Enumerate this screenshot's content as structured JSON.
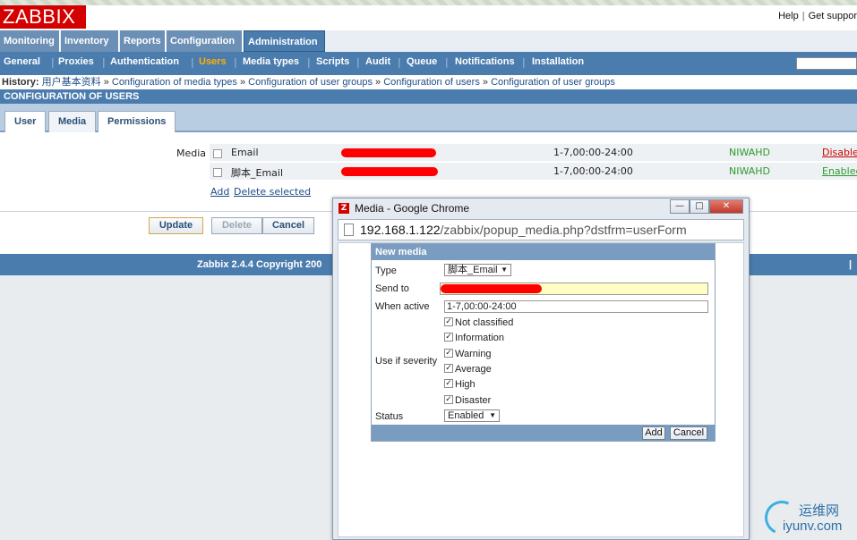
{
  "app": {
    "logo": "ZABBIX",
    "help": "Help",
    "separator": "|",
    "support": "Get suppor"
  },
  "main_menu": [
    {
      "label": "Monitoring"
    },
    {
      "label": "Inventory"
    },
    {
      "label": "Reports"
    },
    {
      "label": "Configuration"
    },
    {
      "label": "Administration"
    }
  ],
  "sub_menu": [
    {
      "label": "General"
    },
    {
      "label": "Proxies"
    },
    {
      "label": "Authentication"
    },
    {
      "label": "Users"
    },
    {
      "label": "Media types"
    },
    {
      "label": "Scripts"
    },
    {
      "label": "Audit"
    },
    {
      "label": "Queue"
    },
    {
      "label": "Notifications"
    },
    {
      "label": "Installation"
    }
  ],
  "history": {
    "label": "History:",
    "items": [
      "用户基本资料",
      "Configuration of media types",
      "Configuration of user groups",
      "Configuration of users",
      "Configuration of user groups"
    ],
    "arrow": "»"
  },
  "page_header": "CONFIGURATION OF USERS",
  "tabs": [
    {
      "label": "User"
    },
    {
      "label": "Media"
    },
    {
      "label": "Permissions"
    }
  ],
  "media_section": {
    "label": "Media",
    "rows": [
      {
        "type": "Email",
        "when": "1-7,00:00-24:00",
        "severity": "NIWAHD",
        "status": "Disabled"
      },
      {
        "type": "脚本_Email",
        "when": "1-7,00:00-24:00",
        "severity": "NIWAHD",
        "status": "Enabled"
      }
    ],
    "add_link": "Add",
    "delete_link": "Delete selected"
  },
  "buttons": {
    "update": "Update",
    "delete": "Delete",
    "cancel": "Cancel"
  },
  "footer": "Zabbix 2.4.4 Copyright 200",
  "footer_right": "|",
  "popup": {
    "title": "Media - Google Chrome",
    "url_host": "192.168.1.122",
    "url_path": "/zabbix/popup_media.php?dstfrm=userForm",
    "form_title": "New media",
    "type_label": "Type",
    "type_value": "脚本_Email",
    "send_to_label": "Send to",
    "when_active_label": "When active",
    "when_active_value": "1-7,00:00-24:00",
    "severity_label": "Use if severity",
    "severities": [
      "Not classified",
      "Information",
      "Warning",
      "Average",
      "High",
      "Disaster"
    ],
    "status_label": "Status",
    "status_value": "Enabled",
    "add_button": "Add",
    "cancel_button": "Cancel",
    "minimize": "—",
    "maximize": "□",
    "close": "✕"
  },
  "watermark": {
    "line1": "运维网",
    "line2": "iyunv.com"
  },
  "colors": {
    "brand_red": "#d40000",
    "nav_blue": "#4b7cae",
    "active_orange": "#ffb000",
    "enabled_green": "#2d9b2d",
    "disabled_red": "#cc0000"
  }
}
